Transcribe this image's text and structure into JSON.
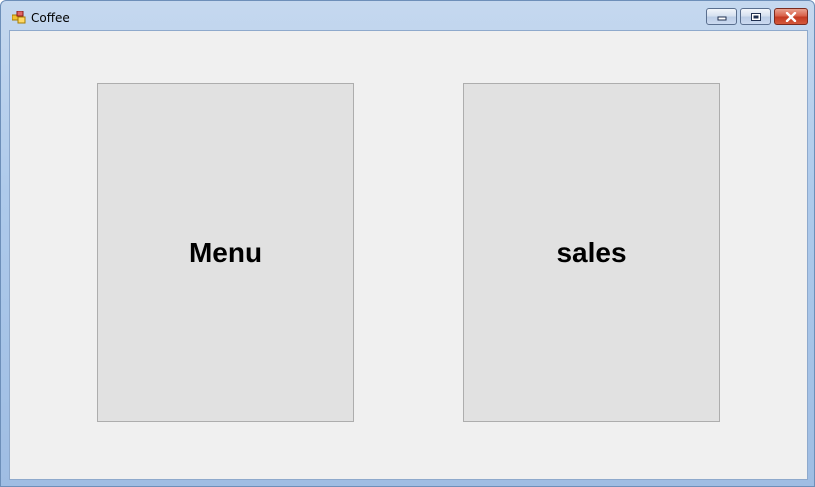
{
  "window": {
    "title": "Coffee",
    "icon": "windows-form-icon",
    "controls": {
      "minimize": "minimize-icon",
      "maximize": "restore-icon",
      "close": "close-icon"
    }
  },
  "main": {
    "menu_button_label": "Menu",
    "sales_button_label": "sales"
  },
  "colors": {
    "form_background": "#f0f0f0",
    "button_face": "#e1e1e1",
    "button_border": "#adadad"
  }
}
